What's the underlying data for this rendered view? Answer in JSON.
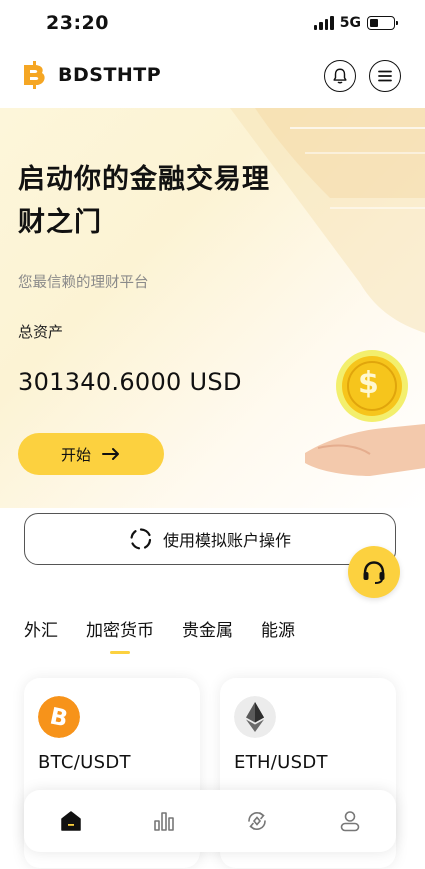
{
  "status_bar": {
    "time": "23:20",
    "network": "5G"
  },
  "header": {
    "logo_text": "BDSTHTP"
  },
  "hero": {
    "title": "启动你的金融交易理财之门",
    "subtitle": "您最信赖的理财平台",
    "assets_label": "总资产",
    "assets_value": "301340.6000 USD",
    "start_label": "开始"
  },
  "demo": {
    "label": "使用模拟账户操作"
  },
  "tabs": [
    {
      "label": "外汇"
    },
    {
      "label": "加密货币"
    },
    {
      "label": "贵金属"
    },
    {
      "label": "能源"
    }
  ],
  "active_tab": 1,
  "cards": [
    {
      "symbol": "BTC/USDT",
      "icon": "bitcoin-icon",
      "color": "#f7931a"
    },
    {
      "symbol": "ETH/USDT",
      "icon": "ethereum-icon",
      "color": "#8a8a8a"
    }
  ],
  "nav": [
    {
      "icon": "home-icon"
    },
    {
      "icon": "chart-icon"
    },
    {
      "icon": "exchange-icon"
    },
    {
      "icon": "profile-icon"
    }
  ],
  "colors": {
    "accent": "#fcd13f",
    "hero_bg": "#fdf6da"
  }
}
